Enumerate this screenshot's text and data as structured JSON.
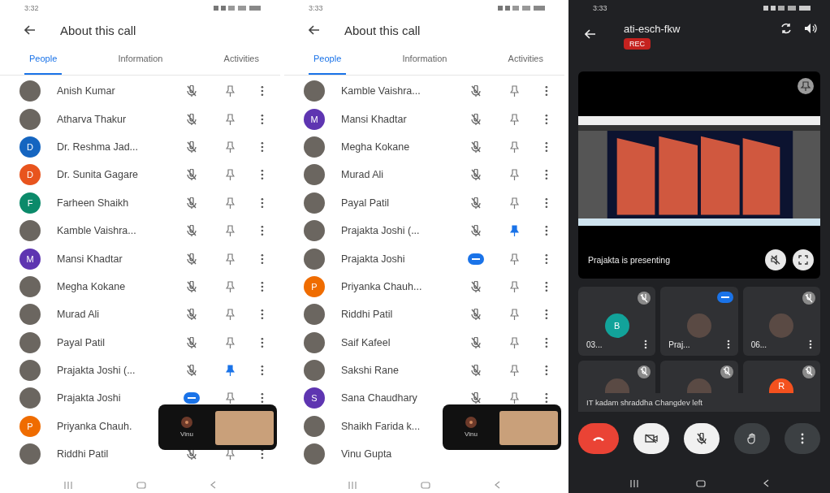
{
  "phones": [
    {
      "time": "3:32",
      "title": "About this call",
      "tabs": [
        {
          "label": "People",
          "selected": true
        },
        {
          "label": "Information",
          "selected": false
        },
        {
          "label": "Activities",
          "selected": false
        }
      ],
      "people": [
        {
          "name": "Anish Kumar",
          "avatar": {
            "kind": "photo"
          },
          "speaking": false,
          "pinned": false
        },
        {
          "name": "Atharva Thakur",
          "avatar": {
            "kind": "photo"
          },
          "speaking": false,
          "pinned": false
        },
        {
          "name": "Dr. Reshma Jad...",
          "avatar": {
            "kind": "letter",
            "letter": "D",
            "color": "#1565c0"
          },
          "speaking": false,
          "pinned": false
        },
        {
          "name": "Dr. Sunita Gagare",
          "avatar": {
            "kind": "letter",
            "letter": "D",
            "color": "#e8541e"
          },
          "speaking": false,
          "pinned": false
        },
        {
          "name": "Farheen Shaikh",
          "avatar": {
            "kind": "letter",
            "letter": "F",
            "color": "#0b8a6a"
          },
          "speaking": false,
          "pinned": false
        },
        {
          "name": "Kamble Vaishra...",
          "avatar": {
            "kind": "photo"
          },
          "speaking": false,
          "pinned": false
        },
        {
          "name": "Mansi Khadtar",
          "avatar": {
            "kind": "letter",
            "letter": "M",
            "color": "#5e35b1"
          },
          "speaking": false,
          "pinned": false
        },
        {
          "name": "Megha Kokane",
          "avatar": {
            "kind": "photo"
          },
          "speaking": false,
          "pinned": false
        },
        {
          "name": "Murad Ali",
          "avatar": {
            "kind": "photo"
          },
          "speaking": false,
          "pinned": false
        },
        {
          "name": "Payal Patil",
          "avatar": {
            "kind": "photo"
          },
          "speaking": false,
          "pinned": false
        },
        {
          "name": "Prajakta Joshi (...",
          "avatar": {
            "kind": "photo"
          },
          "speaking": false,
          "pinned": true
        },
        {
          "name": "Prajakta Joshi",
          "avatar": {
            "kind": "photo"
          },
          "speaking": true,
          "pinned": false
        },
        {
          "name": "Priyanka Chauh.",
          "avatar": {
            "kind": "letter",
            "letter": "P",
            "color": "#ef6c00"
          }
        },
        {
          "name": "Riddhi Patil",
          "avatar": {
            "kind": "photo"
          },
          "speaking": false,
          "pinned": false
        }
      ],
      "pip": {
        "label": "Vinu"
      }
    },
    {
      "time": "3:33",
      "title": "About this call",
      "tabs": [
        {
          "label": "People",
          "selected": true
        },
        {
          "label": "Information",
          "selected": false
        },
        {
          "label": "Activities",
          "selected": false
        }
      ],
      "people": [
        {
          "name": "Kamble Vaishra...",
          "avatar": {
            "kind": "photo"
          },
          "speaking": false,
          "pinned": false
        },
        {
          "name": "Mansi Khadtar",
          "avatar": {
            "kind": "letter",
            "letter": "M",
            "color": "#5e35b1"
          },
          "speaking": false,
          "pinned": false
        },
        {
          "name": "Megha Kokane",
          "avatar": {
            "kind": "photo"
          },
          "speaking": false,
          "pinned": false
        },
        {
          "name": "Murad Ali",
          "avatar": {
            "kind": "photo"
          },
          "speaking": false,
          "pinned": false
        },
        {
          "name": "Payal Patil",
          "avatar": {
            "kind": "photo"
          },
          "speaking": false,
          "pinned": false
        },
        {
          "name": "Prajakta Joshi (...",
          "avatar": {
            "kind": "photo"
          },
          "speaking": false,
          "pinned": true
        },
        {
          "name": "Prajakta Joshi",
          "avatar": {
            "kind": "photo"
          },
          "speaking": true,
          "pinned": false
        },
        {
          "name": "Priyanka Chauh...",
          "avatar": {
            "kind": "letter",
            "letter": "P",
            "color": "#ef6c00"
          },
          "speaking": false,
          "pinned": false
        },
        {
          "name": "Riddhi Patil",
          "avatar": {
            "kind": "photo"
          },
          "speaking": false,
          "pinned": false
        },
        {
          "name": "Saif Kafeel",
          "avatar": {
            "kind": "photo"
          },
          "speaking": false,
          "pinned": false
        },
        {
          "name": "Sakshi Rane",
          "avatar": {
            "kind": "photo"
          },
          "speaking": false,
          "pinned": false
        },
        {
          "name": "Sana Chaudhary",
          "avatar": {
            "kind": "letter",
            "letter": "S",
            "color": "#5e35b1"
          },
          "speaking": false,
          "pinned": false
        },
        {
          "name": "Shaikh Farida k...",
          "avatar": {
            "kind": "photo"
          }
        },
        {
          "name": "Vinu Gupta",
          "avatar": {
            "kind": "photo"
          }
        }
      ],
      "pip": {
        "label": "Vinu"
      }
    }
  ],
  "call": {
    "time": "3:33",
    "meeting_code": "ati-esch-fkw",
    "recording_badge": "REC",
    "presenting_text": "Prajakta is presenting",
    "tiles": [
      {
        "name": "03...",
        "avatar": {
          "kind": "letter",
          "letter": "B",
          "color": "#12a39a"
        },
        "speaking": false
      },
      {
        "name": "Praj...",
        "avatar": {
          "kind": "photo"
        },
        "speaking": true
      },
      {
        "name": "06...",
        "avatar": {
          "kind": "photo"
        },
        "speaking": false
      }
    ],
    "lower_tiles": [
      {
        "avatar": {
          "kind": "photo"
        }
      },
      {
        "avatar": {
          "kind": "photo"
        }
      },
      {
        "avatar": {
          "kind": "letter",
          "letter": "R",
          "color": "#f4511e"
        }
      }
    ],
    "toast": "IT kadam shraddha Changdev left"
  }
}
